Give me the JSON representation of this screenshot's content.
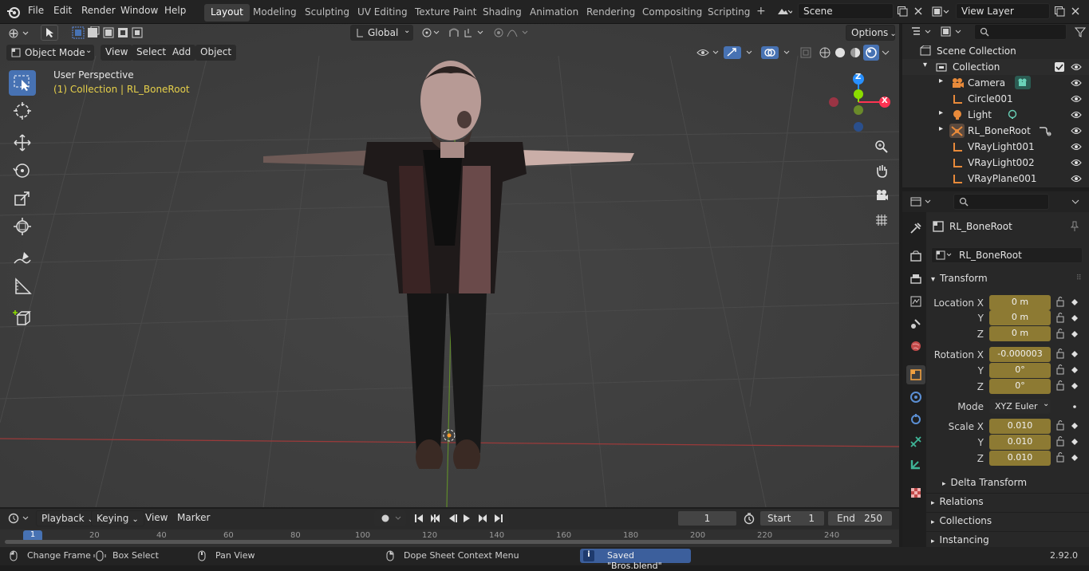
{
  "topbar": {
    "menus": [
      "File",
      "Edit",
      "Render",
      "Window",
      "Help"
    ],
    "workspaces": [
      "Layout",
      "Modeling",
      "Sculpting",
      "UV Editing",
      "Texture Paint",
      "Shading",
      "Animation",
      "Rendering",
      "Compositing",
      "Scripting"
    ],
    "active_workspace": "Layout",
    "add_tab": "+",
    "scene_name": "Scene",
    "view_layer_name": "View Layer"
  },
  "viewport": {
    "orientation": "Global",
    "options_label": "Options",
    "mode": "Object Mode",
    "header_menus": [
      "View",
      "Select",
      "Add",
      "Object"
    ],
    "perspective_label": "User Perspective",
    "collection_label": "(1) Collection | RL_BoneRoot",
    "gizmo": {
      "z": "Z",
      "x": "X"
    }
  },
  "outliner": {
    "scene_collection": "Scene Collection",
    "collection": "Collection",
    "items": [
      {
        "name": "Camera",
        "icon": "camera-icon"
      },
      {
        "name": "Circle001",
        "icon": "bone-icon"
      },
      {
        "name": "Light",
        "icon": "light-icon"
      },
      {
        "name": "RL_BoneRoot",
        "icon": "armature-icon"
      },
      {
        "name": "VRayLight001",
        "icon": "bone-icon"
      },
      {
        "name": "VRayLight002",
        "icon": "bone-icon"
      },
      {
        "name": "VRayPlane001",
        "icon": "bone-icon"
      }
    ]
  },
  "properties": {
    "object_title": "RL_BoneRoot",
    "object_name_field": "RL_BoneRoot",
    "transform_label": "Transform",
    "location": {
      "label_x": "Location X",
      "label_y": "Y",
      "label_z": "Z",
      "x": "0 m",
      "y": "0 m",
      "z": "0 m"
    },
    "rotation": {
      "label_x": "Rotation X",
      "label_y": "Y",
      "label_z": "Z",
      "x": "-0.000003",
      "y": "0°",
      "z": "0°"
    },
    "mode_label": "Mode",
    "mode_value": "XYZ Euler",
    "scale": {
      "label_x": "Scale X",
      "label_y": "Y",
      "label_z": "Z",
      "x": "0.010",
      "y": "0.010",
      "z": "0.010"
    },
    "delta_transform": "Delta Transform",
    "sections": [
      "Relations",
      "Collections",
      "Instancing"
    ]
  },
  "timeline": {
    "menus": [
      "Playback",
      "Keying",
      "View",
      "Marker"
    ],
    "current_frame": "1",
    "start_label": "Start",
    "start_value": "1",
    "end_label": "End",
    "end_value": "250",
    "ruler_ticks": [
      "1",
      "20",
      "40",
      "60",
      "80",
      "100",
      "120",
      "140",
      "160",
      "180",
      "200",
      "220",
      "240"
    ]
  },
  "statusbar": {
    "change_frame": "Change Frame",
    "box_select": "Box Select",
    "pan_view": "Pan View",
    "context_menu": "Dope Sheet Context Menu",
    "saved_message": "Saved \"Bros.blend\"",
    "version": "2.92.0"
  },
  "colors": {
    "accent": "#4772b3",
    "field_yellow": "#8d7a33",
    "x_axis": "#ff3352",
    "y_axis": "#8bdc00",
    "z_axis": "#2890ff",
    "status_blue": "#3c5f9c"
  }
}
